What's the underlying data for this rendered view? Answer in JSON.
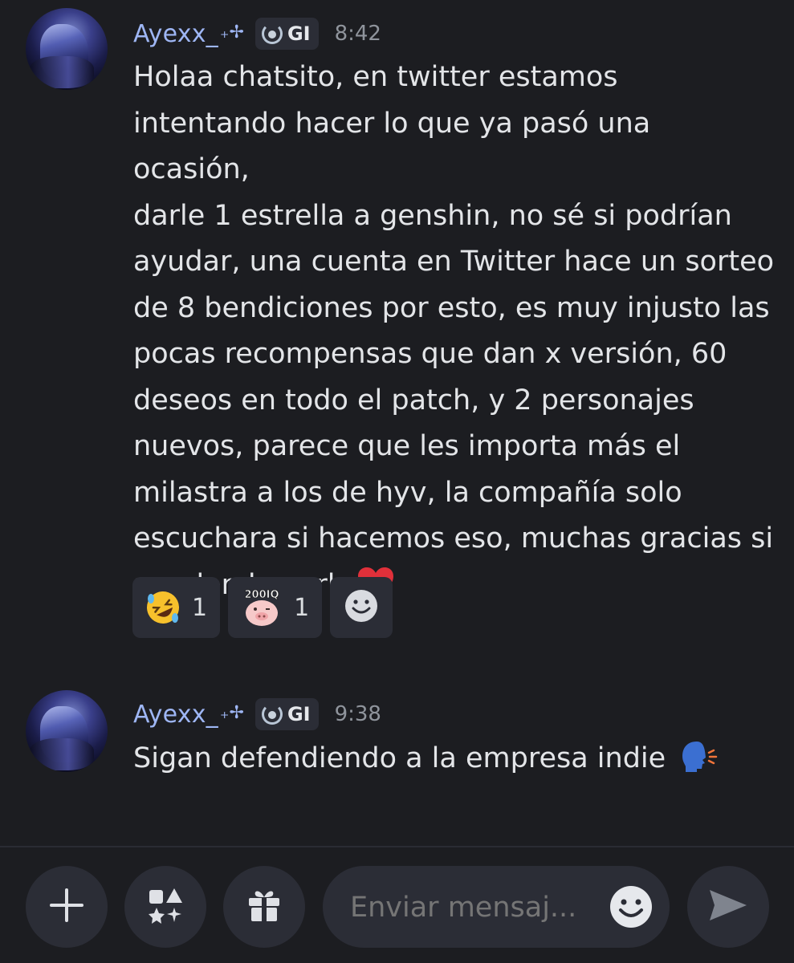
{
  "messages": [
    {
      "username": "Ayexx_",
      "username_suffix": "₊✢",
      "tag": "GI",
      "time": "8:42",
      "lines": [
        "Holaa chatsito, en twitter estamos",
        "intentando hacer lo que ya pasó una ocasión,",
        "darle 1 estrella a genshin, no sé si podrían",
        "ayudar, una cuenta en Twitter hace un sorteo",
        "de 8 bendiciones por esto, es muy injusto las",
        "pocas recompensas que dan x versión, 60",
        "deseos en todo el patch, y 2 personajes",
        "nuevos, parece que les importa más el",
        "milastra a los de hyv, la compañía solo",
        "escuchara si hacemos eso, muchas gracias si",
        "pueden hacerlo"
      ],
      "end_emoji": "red-heart",
      "reactions": [
        {
          "emoji": "rolling-on-floor-laughing",
          "count": "1"
        },
        {
          "emoji": "pig-200iq-sticker",
          "count": "1"
        }
      ]
    },
    {
      "username": "Ayexx_",
      "username_suffix": "₊✢",
      "tag": "GI",
      "time": "9:38",
      "text": "Sigan defendiendo a la empresa indie",
      "end_emoji": "speaking-head"
    }
  ],
  "composer": {
    "placeholder": "Enviar mensaj..."
  },
  "sticker_text": "200IQ",
  "colors": {
    "background": "#1c1d21",
    "username": "#9eb6f4",
    "surface": "#2b2d36",
    "heart": "#e0303a"
  }
}
